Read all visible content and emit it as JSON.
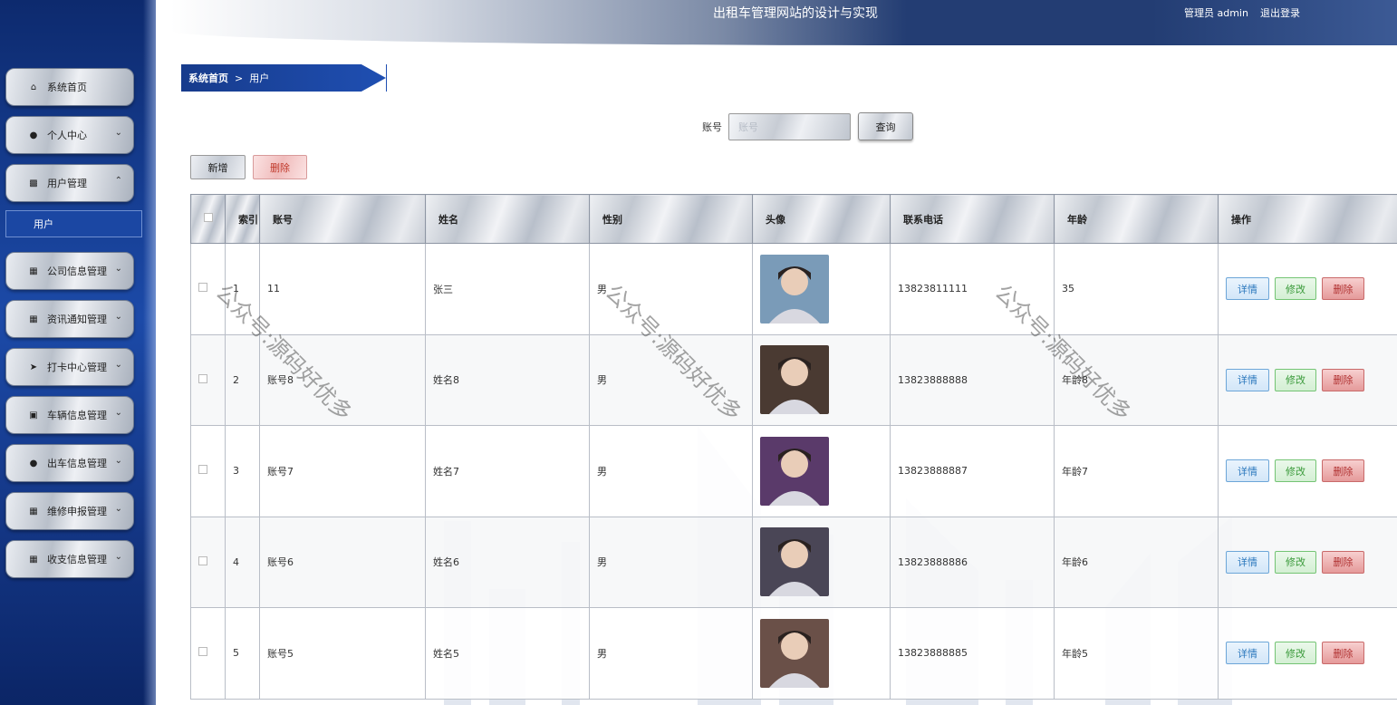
{
  "header": {
    "title": "出租车管理网站的设计与实现",
    "user_label": "管理员 admin",
    "logout_label": "退出登录"
  },
  "sidebar": {
    "items": [
      {
        "label": "系统首页",
        "icon": "home-icon"
      },
      {
        "label": "个人中心",
        "icon": "user-icon"
      },
      {
        "label": "用户管理",
        "icon": "users-icon"
      },
      {
        "label": "公司信息管理",
        "icon": "grid-icon"
      },
      {
        "label": "资讯通知管理",
        "icon": "grid-icon"
      },
      {
        "label": "打卡中心管理",
        "icon": "send-icon"
      },
      {
        "label": "车辆信息管理",
        "icon": "car-icon"
      },
      {
        "label": "出车信息管理",
        "icon": "user-icon"
      },
      {
        "label": "维修申报管理",
        "icon": "grid-icon"
      },
      {
        "label": "收支信息管理",
        "icon": "grid-icon"
      }
    ],
    "sub_item": "用户"
  },
  "breadcrumb": {
    "home": "系统首页",
    "separator": ">",
    "current": "用户"
  },
  "search": {
    "label": "账号",
    "placeholder": "账号",
    "button": "查询"
  },
  "toolbar": {
    "add": "新增",
    "delete": "删除"
  },
  "table": {
    "headers": {
      "index": "索引",
      "account": "账号",
      "name": "姓名",
      "gender": "性别",
      "avatar": "头像",
      "phone": "联系电话",
      "age": "年龄",
      "actions": "操作"
    },
    "rows": [
      {
        "index": "1",
        "account": "11",
        "name": "张三",
        "gender": "男",
        "phone": "13823811111",
        "age": "35",
        "avatar_bg": "#7a9bb8"
      },
      {
        "index": "2",
        "account": "账号8",
        "name": "姓名8",
        "gender": "男",
        "phone": "13823888888",
        "age": "年龄8",
        "avatar_bg": "#4a3a32"
      },
      {
        "index": "3",
        "account": "账号7",
        "name": "姓名7",
        "gender": "男",
        "phone": "13823888887",
        "age": "年龄7",
        "avatar_bg": "#5a3a6a"
      },
      {
        "index": "4",
        "account": "账号6",
        "name": "姓名6",
        "gender": "男",
        "phone": "13823888886",
        "age": "年龄6",
        "avatar_bg": "#4a4656"
      },
      {
        "index": "5",
        "account": "账号5",
        "name": "姓名5",
        "gender": "男",
        "phone": "13823888885",
        "age": "年龄5",
        "avatar_bg": "#6a5048"
      }
    ],
    "actions": {
      "detail": "详情",
      "edit": "修改",
      "delete": "删除"
    }
  },
  "watermark": "公众号:源码好优多"
}
